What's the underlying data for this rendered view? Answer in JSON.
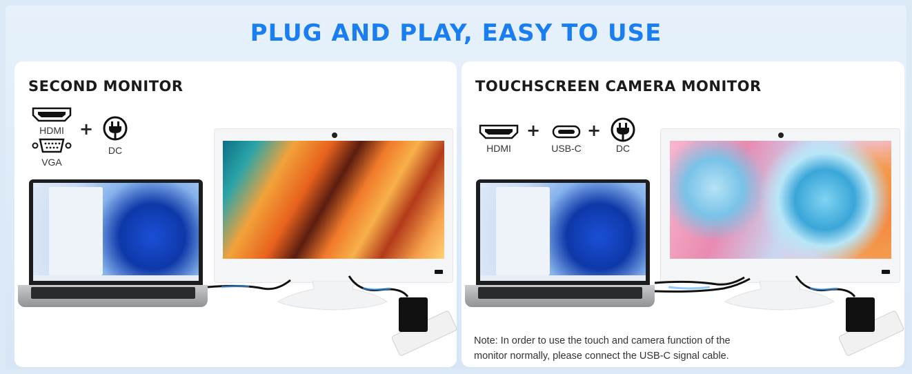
{
  "title": "PLUG AND PLAY, EASY TO USE",
  "left_panel": {
    "heading": "SECOND MONITOR",
    "ports": [
      "HDMI",
      "VGA",
      "DC"
    ]
  },
  "right_panel": {
    "heading": "TOUCHSCREEN CAMERA MONITOR",
    "ports": [
      "HDMI",
      "USB-C",
      "DC"
    ],
    "note_line1": "Note:  In order to use the touch and camera function of the",
    "note_line2": "monitor normally, please connect the USB-C signal cable."
  },
  "colors": {
    "title": "#1a7ef0",
    "background": "#dbe9f7",
    "cable_glow": "#4aa8ff"
  },
  "icons": [
    "hdmi-port-icon",
    "vga-port-icon",
    "dc-power-icon",
    "usb-c-port-icon",
    "plus-icon"
  ]
}
